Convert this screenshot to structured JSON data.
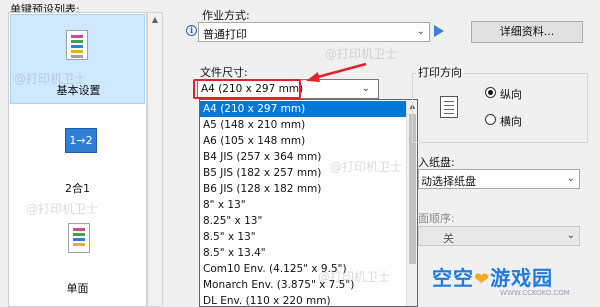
{
  "preset_list": {
    "header": "单键预设列表:",
    "items": [
      {
        "label": "基本设置"
      },
      {
        "label": "2合1",
        "icon_text": "1→2"
      },
      {
        "label": "单面"
      }
    ]
  },
  "job_mode": {
    "label": "作业方式:",
    "value": "普通打印",
    "details_button": "详细资料..."
  },
  "paper_size": {
    "label": "文件尺寸:",
    "value": "A4 (210 x 297 mm)",
    "options": [
      "A4 (210 x 297 mm)",
      "A5 (148 x 210 mm)",
      "A6 (105 x 148 mm)",
      "B4 JIS (257 x 364 mm)",
      "B5 JIS (182 x 257 mm)",
      "B6 JIS (128 x 182 mm)",
      "8\" x 13\"",
      "8.25\" x 13\"",
      "8.5\" x 13\"",
      "8.5\" x 13.4\"",
      "Com10 Env. (4.125\" x 9.5\")",
      "Monarch Env. (3.875\" x 7.5\")",
      "DL Env. (110 x 220 mm)"
    ]
  },
  "orientation": {
    "label": "打印方向",
    "portrait": "纵向",
    "landscape": "横向",
    "selected": "portrait"
  },
  "paper_source": {
    "label": "入纸盘:",
    "value": "动选择纸盘"
  },
  "page_order": {
    "label": "面顺序:",
    "value": "关"
  },
  "watermark": {
    "text": "@打印机卫士",
    "logo_a": "空空",
    "logo_b": "游戏园",
    "url": "WWW.CCKOKO.COM"
  },
  "colors": {
    "selection": "#0078d7",
    "highlight": "#e0222b",
    "accent": "#3d7fd2"
  }
}
